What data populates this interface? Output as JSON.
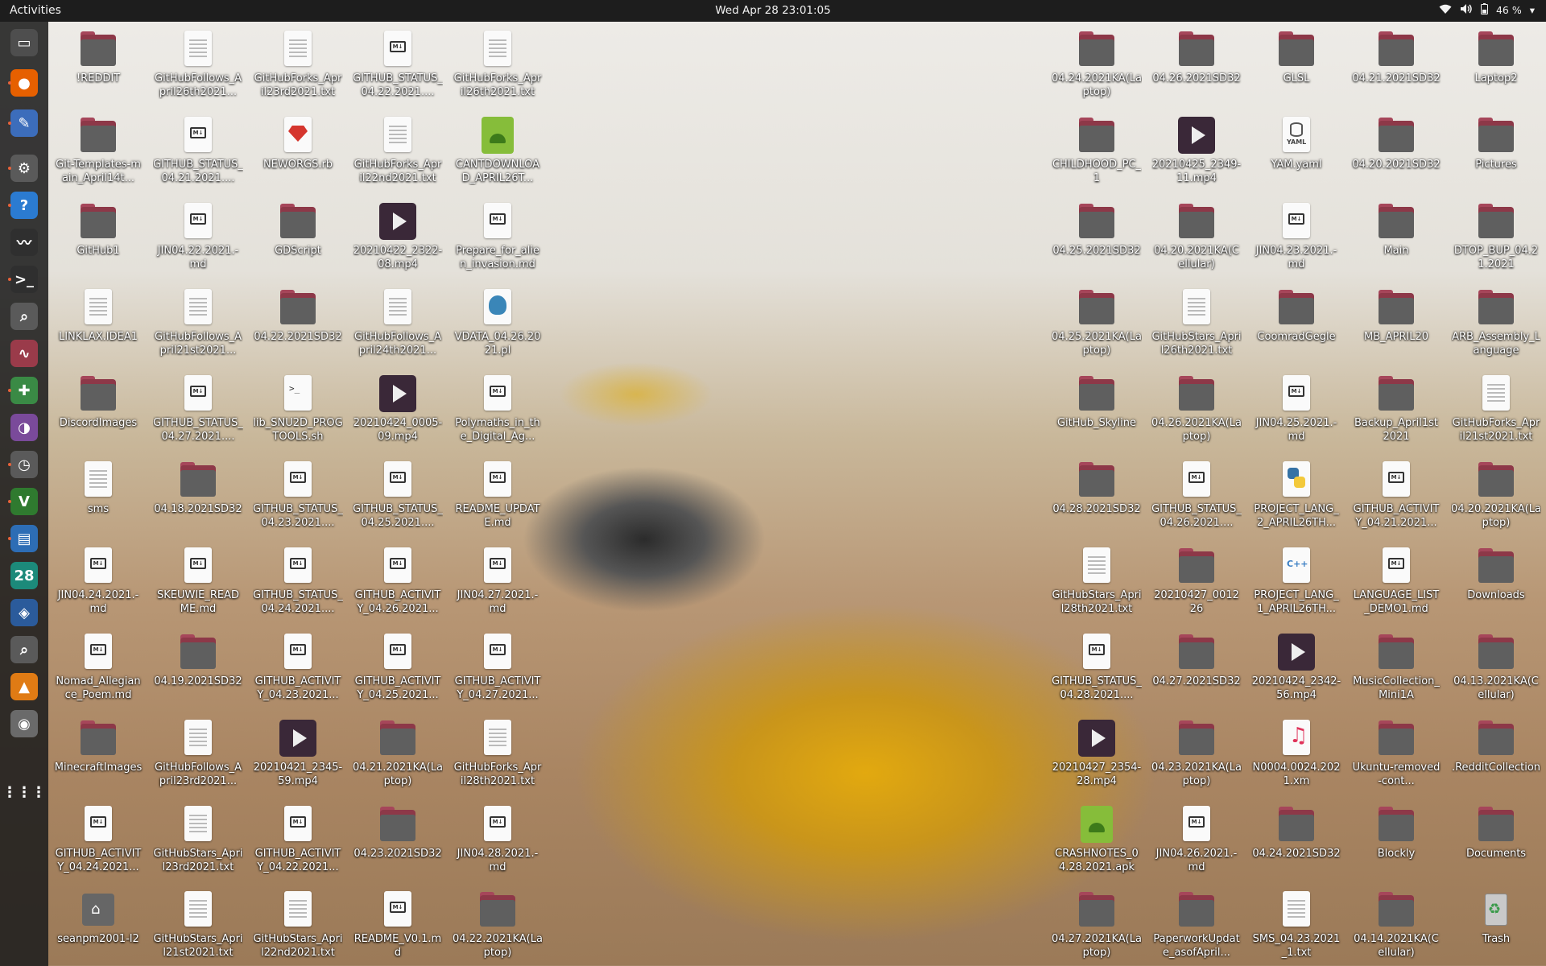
{
  "topbar": {
    "activities": "Activities",
    "clock": "Wed Apr 28  23:01:05",
    "battery": "46 %"
  },
  "dock": [
    {
      "name": "files",
      "icon": "folder-icon",
      "color": "#4e4e4e",
      "glyph": "▭"
    },
    {
      "name": "firefox",
      "icon": "firefox-icon",
      "color": "#e66000",
      "glyph": "●"
    },
    {
      "name": "text-editor",
      "icon": "pencil-icon",
      "color": "#3c6dbb",
      "glyph": "✎"
    },
    {
      "name": "settings",
      "icon": "gear-icon",
      "color": "#5a5a5a",
      "glyph": "⚙"
    },
    {
      "name": "help",
      "icon": "help-icon",
      "color": "#2b7bd1",
      "glyph": "?"
    },
    {
      "name": "system-monitor",
      "icon": "pulse-icon",
      "color": "#2f2f2f",
      "glyph": "〰"
    },
    {
      "name": "terminal",
      "icon": "terminal-icon",
      "color": "#2f2f2f",
      "glyph": ">_"
    },
    {
      "name": "search",
      "icon": "magnifier-icon",
      "color": "#5a5a5a",
      "glyph": "⌕"
    },
    {
      "name": "sound-recorder",
      "icon": "waveform-icon",
      "color": "#9a3b4a",
      "glyph": "∿"
    },
    {
      "name": "puzzle",
      "icon": "puzzle-icon",
      "color": "#3a8a45",
      "glyph": "✚"
    },
    {
      "name": "tweaks",
      "icon": "toggle-icon",
      "color": "#7a4a9a",
      "glyph": "◑"
    },
    {
      "name": "clock",
      "icon": "clock-icon",
      "color": "#5a5a5a",
      "glyph": "◷"
    },
    {
      "name": "vim",
      "icon": "vim-icon",
      "color": "#2f7a2f",
      "glyph": "V"
    },
    {
      "name": "writer",
      "icon": "document-icon",
      "color": "#2d6db5",
      "glyph": "▤"
    },
    {
      "name": "calendar",
      "icon": "calendar-icon",
      "color": "#1c8a7a",
      "glyph": "28"
    },
    {
      "name": "virtualbox",
      "icon": "cube-icon",
      "color": "#2b5b9b",
      "glyph": "◈"
    },
    {
      "name": "search2",
      "icon": "magnifier-icon",
      "color": "#5a5a5a",
      "glyph": "⌕"
    },
    {
      "name": "vlc",
      "icon": "cone-icon",
      "color": "#e07b14",
      "glyph": "▲"
    },
    {
      "name": "disc",
      "icon": "disc-icon",
      "color": "#6a6a6a",
      "glyph": "◉"
    },
    {
      "name": "show-apps",
      "icon": "grid-icon",
      "color": "transparent",
      "glyph": "⋮⋮⋮"
    }
  ],
  "left_columns": [
    [
      {
        "label": "!REDDIT",
        "type": "folder"
      },
      {
        "label": "Git-Templates-main_April14t...",
        "type": "folder"
      },
      {
        "label": "GitHub1",
        "type": "folder"
      },
      {
        "label": "LINKLAX.IDEA1",
        "type": "doc"
      },
      {
        "label": "DiscordImages",
        "type": "folder"
      },
      {
        "label": "sms",
        "type": "doc"
      },
      {
        "label": "JIN04.24.2021.-md",
        "type": "md"
      },
      {
        "label": "Nomad_Allegiance_Poem.md",
        "type": "md"
      },
      {
        "label": "MinecraftImages",
        "type": "folder"
      },
      {
        "label": "GITHUB_ACTIVITY_04.24.2021...",
        "type": "md"
      },
      {
        "label": "seanpm2001-l2",
        "type": "home"
      }
    ],
    [
      {
        "label": "GitHubFollows_April26th2021...",
        "type": "doc"
      },
      {
        "label": "GITHUB_STATUS_04.21.2021....",
        "type": "md"
      },
      {
        "label": "JIN04.22.2021.-md",
        "type": "md"
      },
      {
        "label": "GitHubFollows_April21st2021...",
        "type": "doc"
      },
      {
        "label": "GITHUB_STATUS_04.27.2021....",
        "type": "md"
      },
      {
        "label": "04.18.2021SD32",
        "type": "folder"
      },
      {
        "label": "SKEUWIE_README.md",
        "type": "md"
      },
      {
        "label": "04.19.2021SD32",
        "type": "folder"
      },
      {
        "label": "GitHubFollows_April23rd2021...",
        "type": "doc"
      },
      {
        "label": "GitHubStars_April23rd2021.txt",
        "type": "doc"
      },
      {
        "label": "GitHubStars_April21st2021.txt",
        "type": "doc"
      }
    ],
    [
      {
        "label": "GitHubForks_April23rd2021.txt",
        "type": "doc"
      },
      {
        "label": "NEWORGS.rb",
        "type": "gem"
      },
      {
        "label": "GDScript",
        "type": "folder"
      },
      {
        "label": "04.22.2021SD32",
        "type": "folder"
      },
      {
        "label": "lib_SNU2D_PROGTOOLS.sh",
        "type": "sh"
      },
      {
        "label": "GITHUB_STATUS_04.23.2021....",
        "type": "md"
      },
      {
        "label": "GITHUB_STATUS_04.24.2021....",
        "type": "md"
      },
      {
        "label": "GITHUB_ACTIVITY_04.23.2021...",
        "type": "md"
      },
      {
        "label": "20210421_2345-59.mp4",
        "type": "video"
      },
      {
        "label": "GITHUB_ACTIVITY_04.22.2021...",
        "type": "md"
      },
      {
        "label": "GitHubStars_April22nd2021.txt",
        "type": "doc"
      }
    ],
    [
      {
        "label": "GITHUB_STATUS_04.22.2021....",
        "type": "md"
      },
      {
        "label": "GitHubForks_April22nd2021.txt",
        "type": "doc"
      },
      {
        "label": "20210422_2322-08.mp4",
        "type": "video"
      },
      {
        "label": "GitHubFollows_April24th2021...",
        "type": "doc"
      },
      {
        "label": "20210424_0005-09.mp4",
        "type": "video"
      },
      {
        "label": "GITHUB_STATUS_04.25.2021....",
        "type": "md"
      },
      {
        "label": "GITHUB_ACTIVITY_04.26.2021...",
        "type": "md"
      },
      {
        "label": "GITHUB_ACTIVITY_04.25.2021...",
        "type": "md"
      },
      {
        "label": "04.21.2021KA(Laptop)",
        "type": "folder"
      },
      {
        "label": "04.23.2021SD32",
        "type": "folder"
      },
      {
        "label": "README_V0.1.md",
        "type": "md"
      }
    ],
    [
      {
        "label": "GitHubForks_April26th2021.txt",
        "type": "doc"
      },
      {
        "label": "CANTDOWNLOAD_APRIL26T...",
        "type": "apk"
      },
      {
        "label": "Prepare_for_alien_invasion.md",
        "type": "md"
      },
      {
        "label": "VDATA_04.26.2021.pl",
        "type": "pl"
      },
      {
        "label": "Polymaths_in_the_Digital_Ag...",
        "type": "md"
      },
      {
        "label": "README_UPDATE.md",
        "type": "md"
      },
      {
        "label": "JIN04.27.2021.-md",
        "type": "md"
      },
      {
        "label": "GITHUB_ACTIVITY_04.27.2021...",
        "type": "md"
      },
      {
        "label": "GitHubForks_April28th2021.txt",
        "type": "doc"
      },
      {
        "label": "JIN04.28.2021.-md",
        "type": "md"
      },
      {
        "label": "04.22.2021KA(Laptop)",
        "type": "folder"
      }
    ]
  ],
  "right_columns": [
    [
      {
        "label": "04.24.2021KA(Laptop)",
        "type": "folder"
      },
      {
        "label": "CHILDHOOD_PC_1",
        "type": "folder"
      },
      {
        "label": "04.25.2021SD32",
        "type": "folder"
      },
      {
        "label": "04.25.2021KA(Laptop)",
        "type": "folder"
      },
      {
        "label": "GitHub_Skyline",
        "type": "folder"
      },
      {
        "label": "04.28.2021SD32",
        "type": "folder"
      },
      {
        "label": "GitHubStars_April28th2021.txt",
        "type": "doc"
      },
      {
        "label": "GITHUB_STATUS_04.28.2021....",
        "type": "md"
      },
      {
        "label": "20210427_2354-28.mp4",
        "type": "video"
      },
      {
        "label": "CRASHNOTES_04.28.2021.apk",
        "type": "apk"
      },
      {
        "label": "04.27.2021KA(Laptop)",
        "type": "folder"
      }
    ],
    [
      {
        "label": "04.26.2021SD32",
        "type": "folder"
      },
      {
        "label": "20210425_2349-11.mp4",
        "type": "video"
      },
      {
        "label": "04.20.2021KA(Cellular)",
        "type": "folder"
      },
      {
        "label": "GitHubStars_April26th2021.txt",
        "type": "doc"
      },
      {
        "label": "04.26.2021KA(Laptop)",
        "type": "folder"
      },
      {
        "label": "GITHUB_STATUS_04.26.2021....",
        "type": "md"
      },
      {
        "label": "20210427_001226",
        "type": "folder"
      },
      {
        "label": "04.27.2021SD32",
        "type": "folder"
      },
      {
        "label": "04.23.2021KA(Laptop)",
        "type": "folder"
      },
      {
        "label": "JIN04.26.2021.-md",
        "type": "md"
      },
      {
        "label": "PaperworkUpdate_asofApril...",
        "type": "folder"
      }
    ],
    [
      {
        "label": "GLSL",
        "type": "folder"
      },
      {
        "label": "YAM.yaml",
        "type": "yaml"
      },
      {
        "label": "JIN04.23.2021.-md",
        "type": "md"
      },
      {
        "label": "CoomradGegle",
        "type": "folder"
      },
      {
        "label": "JIN04.25.2021.-md",
        "type": "md"
      },
      {
        "label": "PROJECT_LANG_2_APRIL26TH...",
        "type": "py"
      },
      {
        "label": "PROJECT_LANG_1_APRIL26TH...",
        "type": "cpp"
      },
      {
        "label": "20210424_2342-56.mp4",
        "type": "video"
      },
      {
        "label": "N0004.0024.2021.xm",
        "type": "music"
      },
      {
        "label": "04.24.2021SD32",
        "type": "folder"
      },
      {
        "label": "SMS_04.23.2021_1.txt",
        "type": "doc"
      }
    ],
    [
      {
        "label": "04.21.2021SD32",
        "type": "folder"
      },
      {
        "label": "04.20.2021SD32",
        "type": "folder"
      },
      {
        "label": "Main",
        "type": "folder"
      },
      {
        "label": "MB_APRIL20",
        "type": "folder"
      },
      {
        "label": "Backup_April1st2021",
        "type": "folder"
      },
      {
        "label": "GITHUB_ACTIVITY_04.21.2021...",
        "type": "md"
      },
      {
        "label": "LANGUAGE_LIST_DEMO1.md",
        "type": "md"
      },
      {
        "label": "MusicCollection_Mini1A",
        "type": "folder"
      },
      {
        "label": "Ukuntu-removed-cont...",
        "type": "folder"
      },
      {
        "label": "Blockly",
        "type": "folder"
      },
      {
        "label": "04.14.2021KA(Cellular)",
        "type": "folder"
      }
    ],
    [
      {
        "label": "Laptop2",
        "type": "folder"
      },
      {
        "label": "Pictures",
        "type": "folder"
      },
      {
        "label": "DTOP_BUP_04.21.2021",
        "type": "folder"
      },
      {
        "label": "ARB_Assembly_Language",
        "type": "folder"
      },
      {
        "label": "GitHubForks_April21st2021.txt",
        "type": "doc"
      },
      {
        "label": "04.20.2021KA(Laptop)",
        "type": "folder"
      },
      {
        "label": "Downloads",
        "type": "folder"
      },
      {
        "label": "04.13.2021KA(Cellular)",
        "type": "folder"
      },
      {
        "label": ".RedditCollection",
        "type": "folder"
      },
      {
        "label": "Documents",
        "type": "folder"
      },
      {
        "label": "Trash",
        "type": "trash"
      }
    ]
  ]
}
